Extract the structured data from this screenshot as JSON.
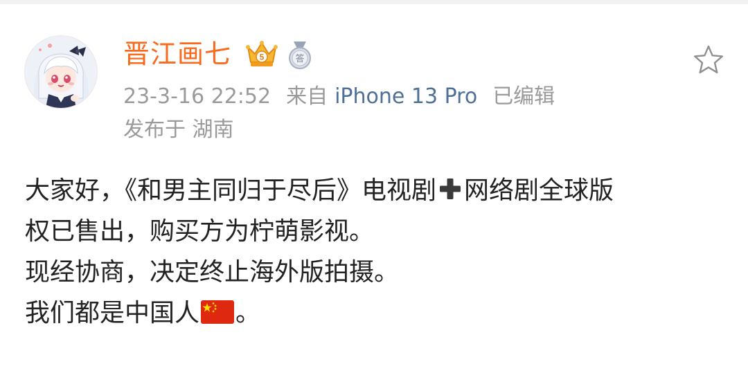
{
  "post": {
    "author": {
      "name": "晋江画七",
      "vip_level": "5",
      "medal_char": "答"
    },
    "meta": {
      "time": "23-3-16 22:52",
      "from_label": "来自",
      "device": "iPhone 13 Pro",
      "edited": "已编辑",
      "location": "发布于 湖南"
    },
    "content": {
      "line1_a": "大家好，《和男主同归于尽后》电视剧",
      "line1_b": "网络剧全球版",
      "line2": "权已售出，购买方为柠萌影视。",
      "line3": "现经协商，决定终止海外版拍摄。",
      "line4_a": "我们都是中国人",
      "line4_b": "。"
    },
    "icons": {
      "favorite": "star-outline-icon",
      "plus": "heavy-plus-emoji",
      "flag": "china-flag-emoji"
    },
    "colors": {
      "username": "#f86a1d",
      "device_link": "#4e6f96",
      "meta": "#9a9a9a",
      "text": "#222222"
    }
  }
}
